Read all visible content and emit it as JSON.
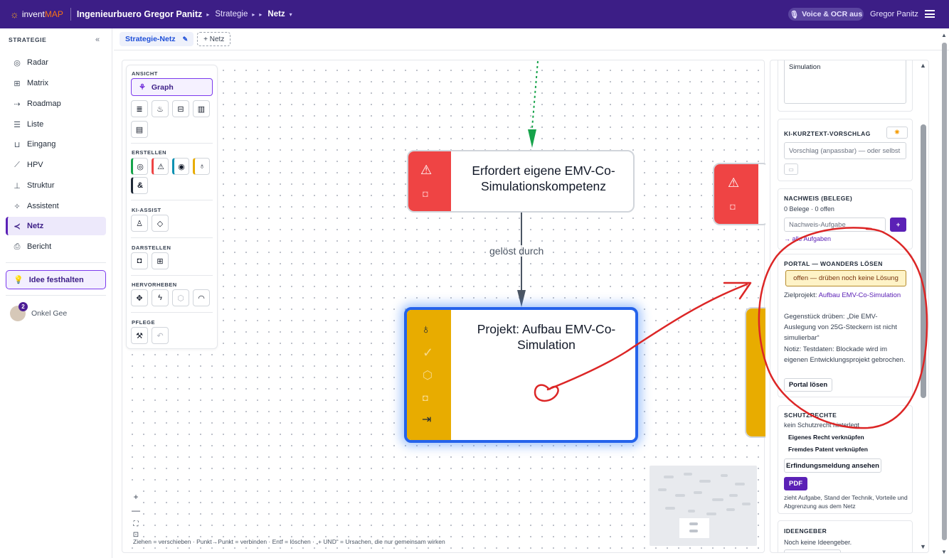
{
  "topbar": {
    "logo_invent": "invent",
    "logo_map": "MAP",
    "org": "Ingenieurbuero Gregor Panitz",
    "crumb1": "Strategie",
    "crumb2": "Netz",
    "voice_badge": "Voice & OCR aus",
    "user": "Gregor Panitz",
    "accent": "#3c1e86"
  },
  "sidebar": {
    "heading": "STRATEGIE",
    "collapse": "«",
    "items": [
      {
        "label": "Radar",
        "icon": "radar-icon"
      },
      {
        "label": "Matrix",
        "icon": "grid-icon"
      },
      {
        "label": "Roadmap",
        "icon": "roadmap-icon"
      },
      {
        "label": "Liste",
        "icon": "list-icon"
      },
      {
        "label": "Eingang",
        "icon": "inbox-icon"
      },
      {
        "label": "HPV",
        "icon": "chart-icon"
      },
      {
        "label": "Struktur",
        "icon": "structure-icon"
      },
      {
        "label": "Assistent",
        "icon": "wand-icon"
      },
      {
        "label": "Netz",
        "icon": "share-icon"
      },
      {
        "label": "Bericht",
        "icon": "printer-icon"
      }
    ],
    "idea_button": "Idee festhalten",
    "user_name": "Onkel Gee",
    "user_badge": "2"
  },
  "tabs": {
    "active": "Strategie-Netz",
    "add": "+ Netz"
  },
  "toolbox": {
    "ansicht": "ANSICHT",
    "graph": "Graph",
    "erstellen": "ERSTELLEN",
    "ki_assist": "KI-ASSIST",
    "darstellen": "DARSTELLEN",
    "hervorheben": "HERVORHEBEN",
    "pflege": "PFLEGE",
    "amp": "&"
  },
  "graph": {
    "node1_title": "Erfordert eigene EMV-Co-Simulationskompetenz",
    "node2_title": "Projekt: Aufbau EMV-Co-Simulation",
    "edge_label": "gelöst durch",
    "colors": {
      "problem": "#ef4444",
      "idea": "#e8ac00",
      "selection": "#2563eb"
    }
  },
  "canvas_hint": "Ziehen = verschieben · Punkt→Punkt = verbinden · Entf = löschen · „+ UND“ = Ursachen, die nur gemeinsam wirken",
  "panel": {
    "textarea_value": "Simulation",
    "ki_heading": "KI-KURZTEXT-VORSCHLAG",
    "ki_placeholder": "Vorschlag (anpassbar) — oder selbst",
    "nachweis_heading": "NACHWEIS (BELEGE)",
    "nachweis_count": "0 Belege · 0 offen",
    "nachweis_placeholder": "Nachweis-Aufgabe",
    "nachweis_add": "+",
    "alle_aufgaben": "→ alle Aufgaben",
    "portal_heading": "PORTAL — WOANDERS LÖSEN",
    "portal_status": "offen — drüben noch keine Lösung",
    "zielprojekt_label": "Zielprojekt: ",
    "zielprojekt_link": "Aufbau EMV-Co-Simulation",
    "gegenstueck": "Gegenstück drüben: „Die EMV-Auslegung von 25G-Steckern ist nicht simulierbar“",
    "notiz": "Notiz: Testdaten: Blockade wird im eigenen Entwicklungsprojekt gebrochen.",
    "portal_button": "Portal lösen",
    "schutz_heading": "SCHUTZRECHTE",
    "schutz_status": "kein Schutzrecht hinterlegt",
    "eigenes": "Eigenes Recht verknüpfen",
    "fremdes": "Fremdes Patent verknüpfen",
    "erfindung": "Erfindungsmeldung ansehen",
    "pdf": "PDF",
    "pdf_desc": "zieht Aufgabe, Stand der Technik, Vorteile und Abgrenzung aus dem Netz",
    "ideengeber_heading": "IDEENGEBER",
    "ideengeber_status": "Noch keine Ideengeber."
  }
}
